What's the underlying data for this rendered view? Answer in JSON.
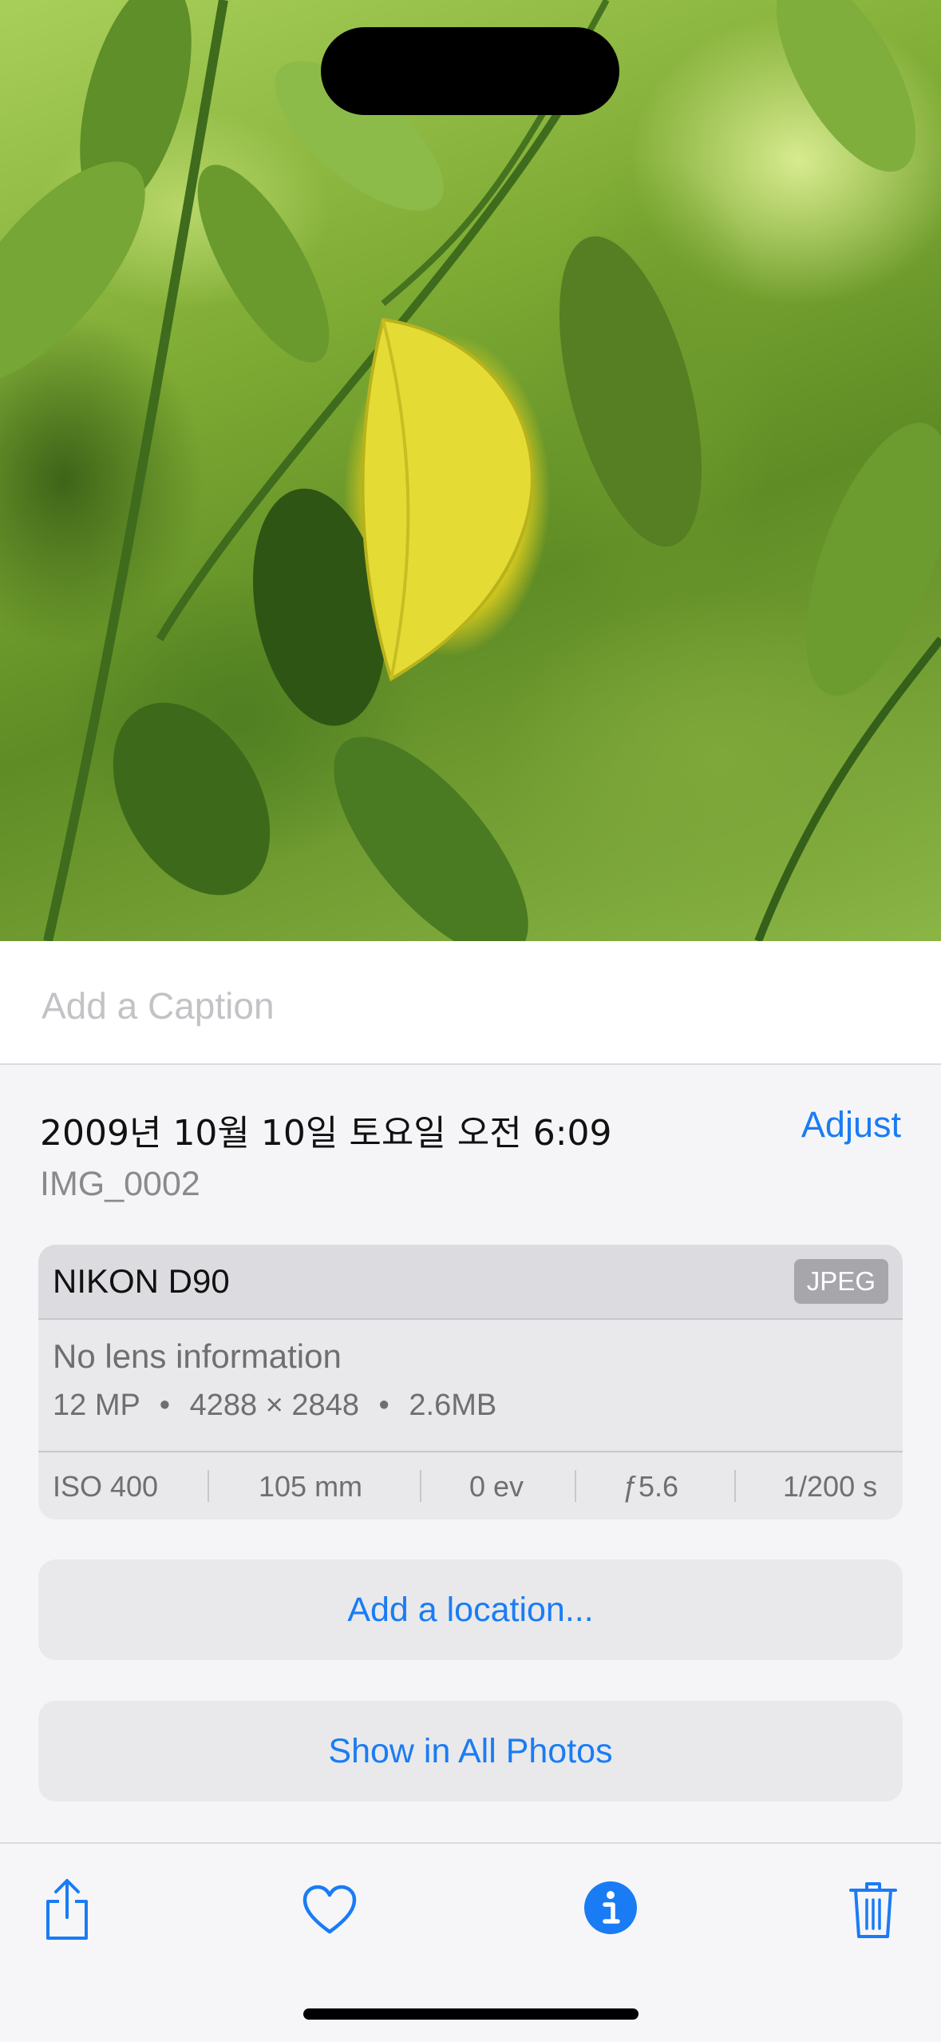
{
  "caption": {
    "placeholder": "Add a Caption"
  },
  "info": {
    "datetime": "2009년 10월 10일 토요일 오전 6:09",
    "adjust_label": "Adjust",
    "filename": "IMG_0002"
  },
  "exif": {
    "camera": "NIKON D90",
    "format": "JPEG",
    "lens": "No lens information",
    "megapixels": "12 MP",
    "resolution": "4288 × 2848",
    "filesize": "2.6MB",
    "bullet": "•",
    "iso": "ISO 400",
    "focal_length": "105 mm",
    "exposure_value": "0 ev",
    "aperture": "ƒ5.6",
    "shutter": "1/200 s"
  },
  "actions": {
    "add_location": "Add a location...",
    "show_all_photos": "Show in All Photos"
  },
  "toolbar": {
    "icons": [
      "share-icon",
      "heart-icon",
      "info-icon",
      "trash-icon"
    ]
  },
  "colors": {
    "accent": "#1a7cf5",
    "leaf_yellow": "#e4dc35"
  }
}
